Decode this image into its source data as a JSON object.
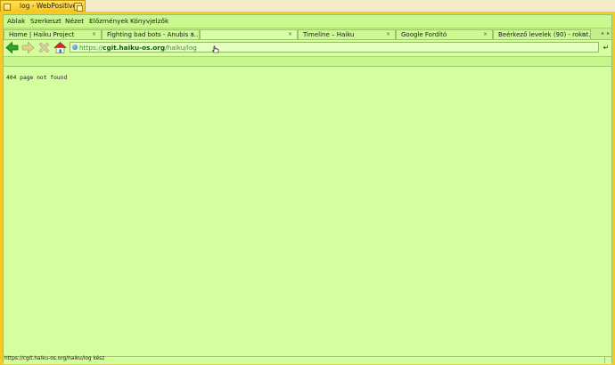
{
  "window": {
    "title": "log - WebPositive"
  },
  "menu": [
    "Ablak",
    "Szerkeszt",
    "Nézet",
    "Előzmények",
    "Könyvjelzők"
  ],
  "tabs": [
    {
      "label": "Home | Haiku Project",
      "active": false
    },
    {
      "label": "Fighting bad bots - Anubis a...",
      "active": false
    },
    {
      "label": "",
      "active": true
    },
    {
      "label": "Timeline – Haiku",
      "active": false
    },
    {
      "label": "Google Fordító",
      "active": false
    },
    {
      "label": "Beérkező levelek (90) - rokat...",
      "active": false
    }
  ],
  "tab_close_glyph": "×",
  "tab_scroll": {
    "left": "◂",
    "right": "▸"
  },
  "url": {
    "scheme": "https://",
    "host": "cgit.haiku-os.org",
    "path": "/haiku/log"
  },
  "go_glyph": "↵",
  "page": {
    "message": "404 page not found"
  },
  "status": "https://cgit.haiku-os.org/haiku/log kész",
  "colors": {
    "window_tab": "#f7c51a",
    "chrome": "#c9f88f",
    "page_bg": "#d5ff9f",
    "back_arrow": "#2fa52f",
    "forward_arrow": "#e0d38e",
    "stop": "#d8cfa3",
    "home_roof": "#c83224",
    "url_host": "#0c5a0c"
  },
  "icons": [
    "back-arrow-icon",
    "forward-arrow-icon",
    "stop-icon",
    "home-icon",
    "globe-icon",
    "close-icon"
  ]
}
